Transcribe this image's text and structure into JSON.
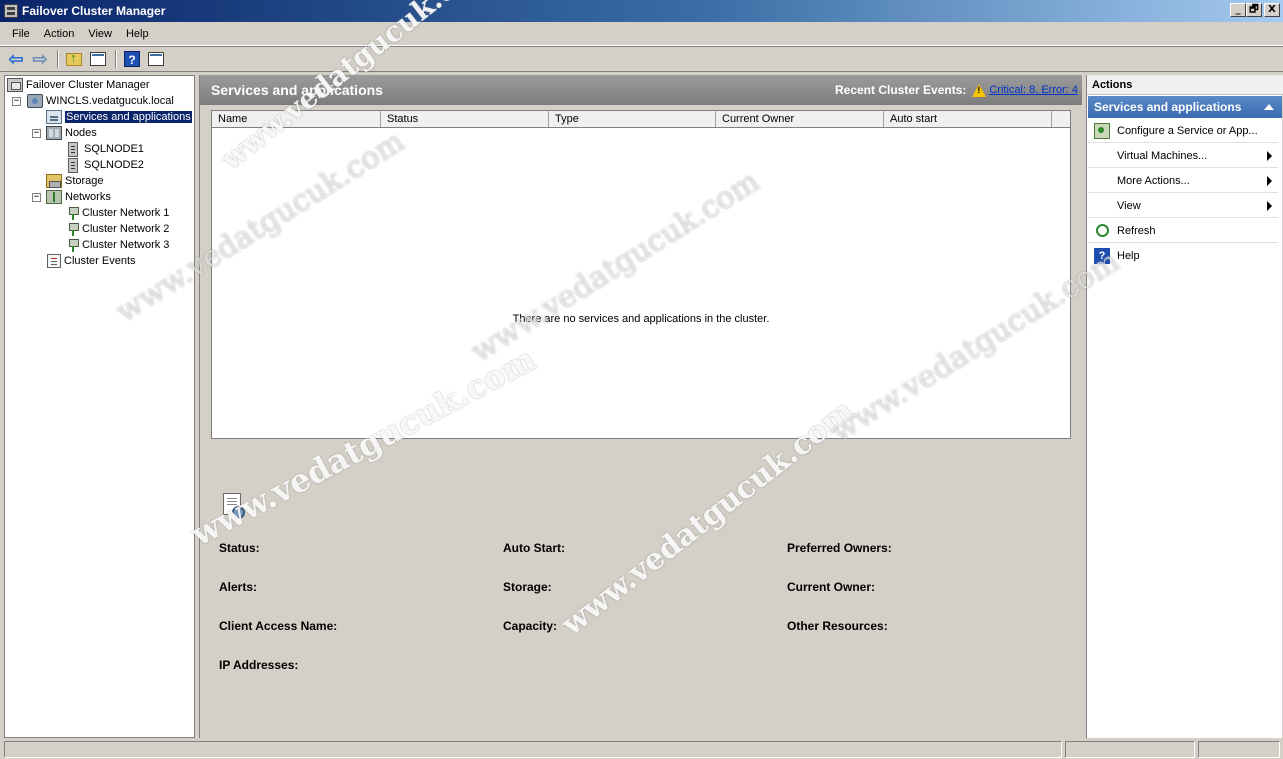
{
  "window": {
    "title": "Failover Cluster Manager",
    "min_label": "_",
    "restore_label": "🗗",
    "close_label": "X"
  },
  "menu": [
    "File",
    "Action",
    "View",
    "Help"
  ],
  "toolbar": {
    "back_icon": "back-arrow-icon",
    "forward_icon": "forward-arrow-icon",
    "up_icon": "up-folder-icon",
    "console_icon": "console-tree-icon",
    "help_icon": "help-icon",
    "help_label": "?",
    "pane_icon": "action-pane-icon"
  },
  "tree": {
    "root": "Failover Cluster Manager",
    "cluster": "WINCLS.vedatgucuk.local",
    "services": "Services and applications",
    "nodes": "Nodes",
    "node1": "SQLNODE1",
    "node2": "SQLNODE2",
    "storage": "Storage",
    "networks": "Networks",
    "network1": "Cluster Network 1",
    "network2": "Cluster Network 2",
    "network3": "Cluster Network 3",
    "events": "Cluster Events",
    "expanded_glyph": "−"
  },
  "center": {
    "title": "Services and applications",
    "recent_label": "Recent Cluster Events:",
    "recent_link": "Critical: 8, Error: 4",
    "columns": [
      "Name",
      "Status",
      "Type",
      "Current Owner",
      "Auto start"
    ],
    "empty_message": "There are no services and applications in the cluster.",
    "details": {
      "status": "Status:",
      "auto_start": "Auto Start:",
      "preferred_owners": "Preferred Owners:",
      "alerts": "Alerts:",
      "storage": "Storage:",
      "current_owner": "Current Owner:",
      "client_access_name": "Client Access Name:",
      "capacity": "Capacity:",
      "other_resources": "Other Resources:",
      "ip_addresses": "IP Addresses:"
    }
  },
  "actions": {
    "title": "Actions",
    "section": "Services and applications",
    "items": [
      "Configure a Service or App...",
      "Virtual Machines...",
      "More Actions...",
      "View",
      "Refresh",
      "Help"
    ],
    "help_glyph": "?"
  },
  "watermark": "www.vedatgucuk.com"
}
